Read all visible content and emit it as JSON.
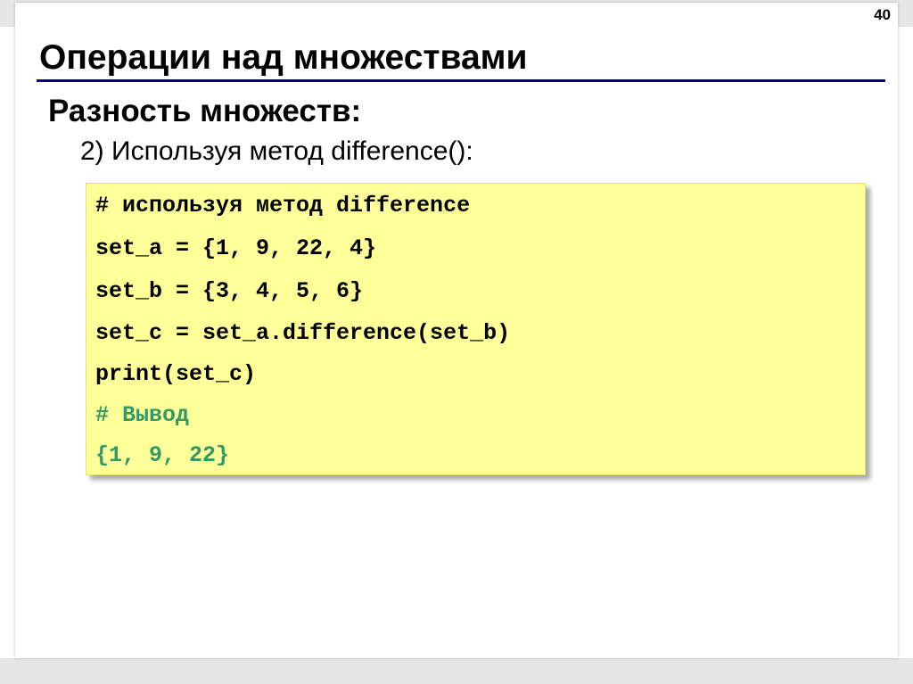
{
  "slide": {
    "number": "40",
    "title": "Операции над множествами",
    "section_heading": "Разность множеств:",
    "item_text": "2) Используя метод difference():",
    "code": {
      "comment": "# используя метод difference",
      "line_set_a": "set_a = {1, 9, 22, 4}",
      "line_set_b": "set_b = {3, 4, 5, 6}",
      "line_set_c": "set_c = set_a.difference(set_b)",
      "line_print": "print(set_c)",
      "output_comment": "# Вывод",
      "output": "{1, 9, 22}"
    }
  },
  "colors": {
    "title_rule": "#000080",
    "code_background": "#ffff99",
    "output_text": "#339966"
  }
}
